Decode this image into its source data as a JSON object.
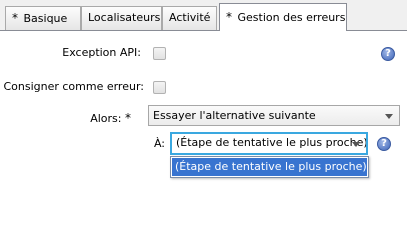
{
  "tabs": [
    {
      "label": "Basique",
      "required": true
    },
    {
      "label": "Localisateurs",
      "required": false
    },
    {
      "label": "Activité",
      "required": false
    },
    {
      "label": "Gestion des erreurs",
      "required": true
    }
  ],
  "required_marker": "*",
  "form": {
    "api_exception_label": "Exception API:",
    "log_as_error_label": "Consigner comme erreur:",
    "then_label": "Alors:",
    "then_value": "Essayer l'alternative suivante",
    "to_label": "À:",
    "to_value": "(Étape de tentative le plus proche)",
    "help_glyph": "?"
  },
  "dropdown": {
    "options": [
      "(Étape de tentative le plus proche)"
    ],
    "highlighted_index": 0
  },
  "colors": {
    "focus_border": "#3aa8e0",
    "highlight": "#3874d0",
    "help_icon": "#3d64b8"
  }
}
